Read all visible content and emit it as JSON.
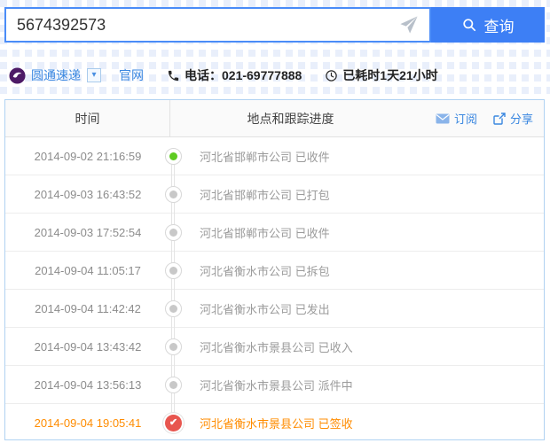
{
  "search": {
    "value": "5674392573",
    "button_label": "查询"
  },
  "courier": {
    "name": "圆通速递",
    "official_site_label": "官网",
    "phone_text": "电话：021-69777888",
    "elapsed_text": "已耗时1天21小时"
  },
  "table": {
    "col_time": "时间",
    "col_progress": "地点和跟踪进度",
    "subscribe_label": "订阅",
    "share_label": "分享",
    "rows": [
      {
        "time": "2014-09-02 21:16:59",
        "status": "河北省邯郸市公司 已收件",
        "marker": "green-dot"
      },
      {
        "time": "2014-09-03 16:43:52",
        "status": "河北省邯郸市公司 已打包",
        "marker": "gray-dot"
      },
      {
        "time": "2014-09-03 17:52:54",
        "status": "河北省邯郸市公司 已收件",
        "marker": "gray-dot"
      },
      {
        "time": "2014-09-04 11:05:17",
        "status": "河北省衡水市公司 已拆包",
        "marker": "gray-dot"
      },
      {
        "time": "2014-09-04 11:42:42",
        "status": "河北省衡水市公司 已发出",
        "marker": "gray-dot"
      },
      {
        "time": "2014-09-04 13:43:42",
        "status": "河北省衡水市景县公司 已收入",
        "marker": "gray-dot"
      },
      {
        "time": "2014-09-04 13:56:13",
        "status": "河北省衡水市景县公司 派件中",
        "marker": "gray-dot"
      },
      {
        "time": "2014-09-04 19:05:41",
        "status": "河北省衡水市景县公司 已签收",
        "marker": "red-check",
        "highlight": true
      }
    ]
  },
  "icons": {
    "caret_glyph": "▾",
    "check_glyph": "✔"
  },
  "colors": {
    "accent_blue": "#3d7ff5",
    "link_blue": "#3a87e0",
    "table_border_blue": "#b0d2f2",
    "highlight_orange": "#ff8c00",
    "success_green": "#5ecb21",
    "delivered_red": "#e8564f",
    "logo_purple": "#4d1a66"
  }
}
